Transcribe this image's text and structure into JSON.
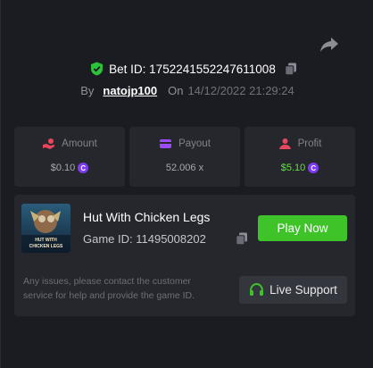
{
  "header": {
    "bet_id_label": "Bet ID: 1752241552247611008",
    "by_label": "By",
    "username": "natojp100",
    "on_label": "On",
    "datetime": "14/12/2022 21:29:24",
    "icons": [
      "share-icon",
      "shield-check-icon",
      "copy-icon"
    ]
  },
  "stats": [
    {
      "label": "Amount",
      "value": "$0.10",
      "icon": "hand-coin-icon",
      "color": "#e8475d"
    },
    {
      "label": "Payout",
      "value": "52.006 x",
      "icon": "wallet-icon",
      "color": "#9b4cf6"
    },
    {
      "label": "Profit",
      "value": "$5.10",
      "icon": "user-coin-icon",
      "color": "#e8475d"
    }
  ],
  "coin_symbol": "C",
  "game": {
    "title": "Hut With Chicken Legs",
    "id_label": "Game ID: 11495008202",
    "thumb_text": "HUT WITH CHICKEN LEGS",
    "play_label": "Play Now"
  },
  "support": {
    "notice": "Any issues, please contact the customer service for help and provide the game ID.",
    "button_label": "Live Support",
    "icon": "headset-icon"
  },
  "colors": {
    "accent_green": "#3ec329",
    "profit_green": "#5ee33a",
    "coin_purple": "#7a3bf1",
    "shield_green": "#2ec13b"
  }
}
